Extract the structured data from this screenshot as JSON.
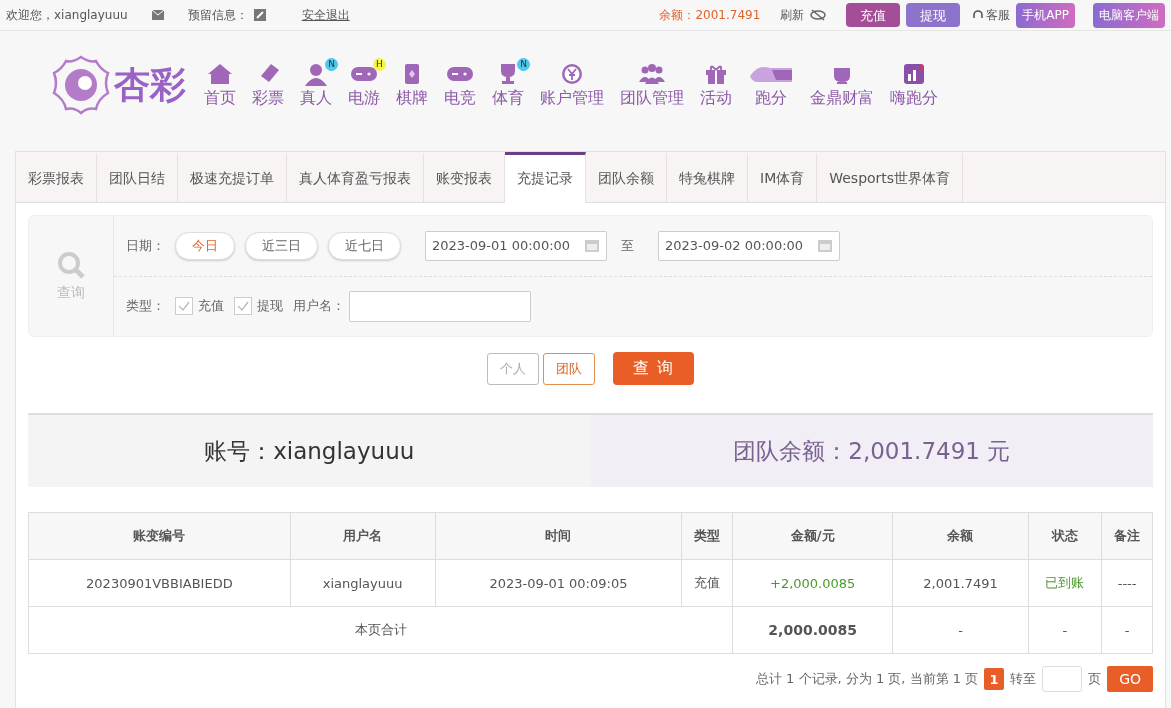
{
  "top_bar": {
    "welcome": "欢迎您，xianglayuuu",
    "reserved_label": "预留信息：",
    "logout": "安全退出",
    "balance": "余额：2001.7491",
    "refresh": "刷新",
    "actions": [
      {
        "label": "充值",
        "kind": "deposit"
      },
      {
        "label": "提现",
        "kind": "withdraw"
      }
    ],
    "service": "客服",
    "apps": [
      "手机APP",
      "电脑客户端"
    ]
  },
  "logo": {
    "text": "杏彩"
  },
  "nav": [
    {
      "label": "首页"
    },
    {
      "label": "彩票"
    },
    {
      "label": "真人",
      "badge": {
        "text": "N",
        "color": "#4cc9f0"
      }
    },
    {
      "label": "电游",
      "badge": {
        "text": "H",
        "color": "#f5f542"
      }
    },
    {
      "label": "棋牌"
    },
    {
      "label": "电竞"
    },
    {
      "label": "体育",
      "badge": {
        "text": "N",
        "color": "#4cc9f0"
      }
    },
    {
      "label": "账户管理"
    },
    {
      "label": "团队管理"
    },
    {
      "label": "活动"
    },
    {
      "label": "跑分"
    },
    {
      "label": "金鼎财富"
    },
    {
      "label": "嗨跑分"
    }
  ],
  "tabs": [
    {
      "label": "彩票报表",
      "selected": false
    },
    {
      "label": "团队日结",
      "selected": false
    },
    {
      "label": "极速充提订单",
      "selected": false
    },
    {
      "label": "真人体育盈亏报表",
      "selected": false
    },
    {
      "label": "账变报表",
      "selected": false
    },
    {
      "label": "充提记录",
      "selected": true
    },
    {
      "label": "团队余额",
      "selected": false
    },
    {
      "label": "特兔棋牌",
      "selected": false
    },
    {
      "label": "IM体育",
      "selected": false
    },
    {
      "label": "Wesports世界体育",
      "selected": false
    }
  ],
  "filter": {
    "search_label": "查询",
    "date_label": "日期：",
    "ranges": [
      {
        "label": "今日",
        "selected": true
      },
      {
        "label": "近三日",
        "selected": false
      },
      {
        "label": "近七日",
        "selected": false
      }
    ],
    "from": "2023-09-01 00:00:00",
    "to_label": "至",
    "to": "2023-09-02 00:00:00",
    "type_label": "类型：",
    "types": [
      {
        "label": "充值",
        "checked": true
      },
      {
        "label": "提现",
        "checked": true
      }
    ],
    "username_label": "用户名："
  },
  "scope": [
    {
      "label": "个人",
      "selected": false
    },
    {
      "label": "团队",
      "selected": true
    }
  ],
  "query_button": "查 询",
  "summary": {
    "account": "账号：xianglayuuu",
    "team_balance": "团队余额：2,001.7491 元"
  },
  "table": {
    "columns": [
      "账变编号",
      "用户名",
      "时间",
      "类型",
      "金额/元",
      "余额",
      "状态",
      "备注"
    ],
    "rows": [
      [
        "20230901VBBIABIEDD",
        "xianglayuuu",
        "2023-09-01 00:09:05",
        "充值",
        "+2,000.0085",
        "2,001.7491",
        "已到账",
        "----"
      ]
    ],
    "total": {
      "label": "本页合计",
      "amount": "2,000.0085",
      "balance": "-",
      "status": "-",
      "note": "-"
    }
  },
  "pagination": {
    "summary": "总计 1 个记录, 分为 1 页, 当前第 1 页",
    "pages": [
      {
        "label": "1",
        "selected": true
      }
    ],
    "goto": "转至",
    "page_unit": "页",
    "go": "GO"
  }
}
